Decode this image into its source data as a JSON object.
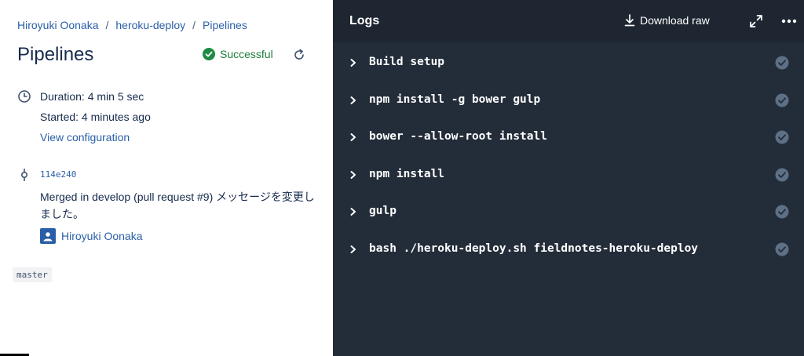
{
  "breadcrumb": {
    "items": [
      "Hiroyuki Oonaka",
      "heroku-deploy",
      "Pipelines"
    ],
    "separator": "/"
  },
  "page": {
    "title": "Pipelines",
    "status_label": "Successful",
    "status_color": "#1e8a45"
  },
  "build": {
    "duration": "Duration: 4 min 5 sec",
    "started": "Started: 4 minutes ago",
    "view_configuration": "View configuration"
  },
  "commit": {
    "hash": "114e240",
    "message": "Merged in develop (pull request #9) メッセージを変更しました。",
    "author": "Hiroyuki Oonaka"
  },
  "branch": "master",
  "logs": {
    "title": "Logs",
    "download_label": "Download raw",
    "steps": [
      "Build setup",
      "npm install -g bower gulp",
      "bower --allow-root install",
      "npm install",
      "gulp",
      "bash ./heroku-deploy.sh fieldnotes-heroku-deploy"
    ]
  },
  "icons": {
    "status": "check-circle-icon",
    "rerun": "rerun-icon",
    "duration": "clock-icon",
    "commit": "commit-icon",
    "author": "avatar-icon",
    "download": "download-icon",
    "expand": "expand-icon",
    "more": "more-icon",
    "step_toggle": "chevron-right-icon",
    "step_done": "check-circle-icon"
  },
  "colors": {
    "link": "#2a5fa8",
    "log_background": "#232d39",
    "log_header": "#1d2631",
    "step_done": "#5d7086"
  }
}
